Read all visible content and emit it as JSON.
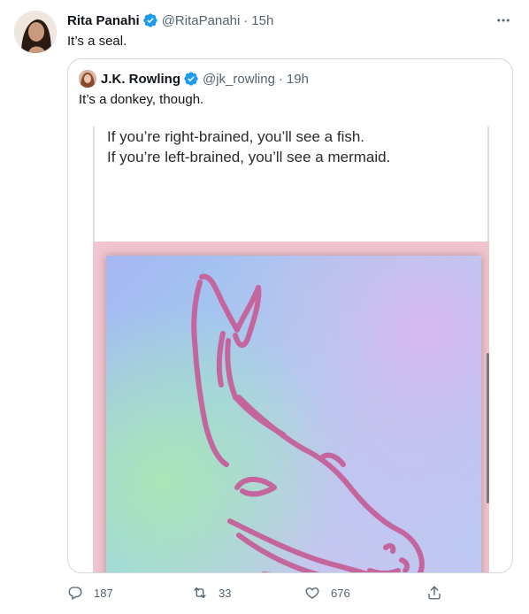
{
  "tweet": {
    "author_name": "Rita Panahi",
    "author_handle": "@RitaPanahi",
    "separator": "·",
    "time": "15h",
    "text": "It’s a seal."
  },
  "quoted": {
    "author_name": "J.K. Rowling",
    "author_handle": "@jk_rowling",
    "separator": "·",
    "time": "19h",
    "text": "It’s a donkey, though.",
    "media_caption_line1": "If you’re right-brained, you’ll see a fish.",
    "media_caption_line2": "If you’re left-brained, you’ll see a mermaid."
  },
  "actions": {
    "replies": "187",
    "retweets": "33",
    "likes": "676"
  },
  "icons": {
    "verified": "verified-badge-icon",
    "more": "more-horizontal-icon",
    "reply": "reply-icon",
    "retweet": "retweet-icon",
    "like": "heart-icon",
    "share": "share-icon"
  },
  "colors": {
    "verified_blue": "#1d9bf0",
    "muted": "#536471",
    "drawing_stroke": "#c4659d"
  }
}
